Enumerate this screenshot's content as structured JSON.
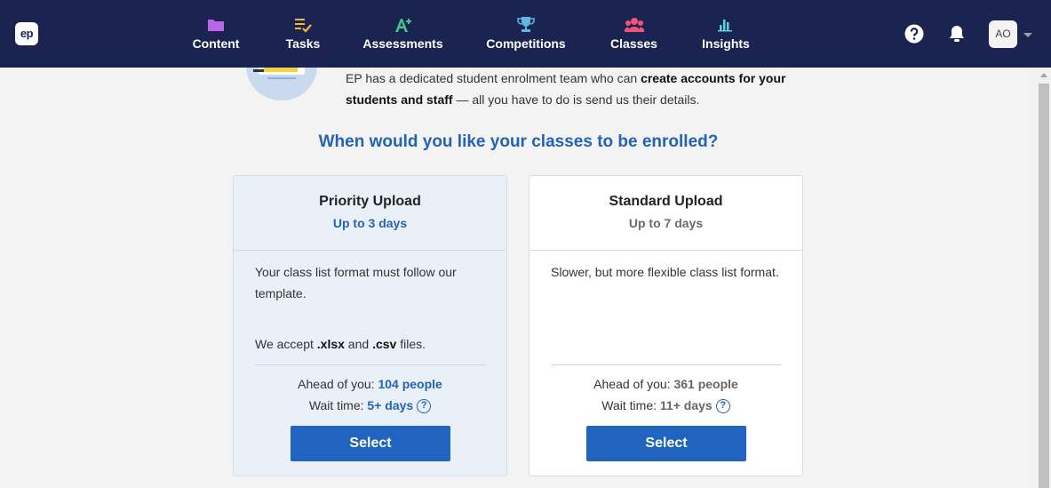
{
  "header": {
    "logo_text": "ep",
    "nav": [
      {
        "label": "Content",
        "icon": "folder-icon",
        "color": "#b967e8"
      },
      {
        "label": "Tasks",
        "icon": "tasks-icon",
        "color": "#f5b82e"
      },
      {
        "label": "Assessments",
        "icon": "assessment-icon",
        "color": "#3cc78a"
      },
      {
        "label": "Competitions",
        "icon": "trophy-icon",
        "color": "#5fb6e0"
      },
      {
        "label": "Classes",
        "icon": "classes-icon",
        "color": "#f0547a"
      },
      {
        "label": "Insights",
        "icon": "insights-icon",
        "color": "#5ad1e6"
      }
    ],
    "avatar_initials": "AO"
  },
  "intro": {
    "text_a": "EP has a dedicated student enrolment team who can ",
    "text_bold": "create accounts for your students and staff",
    "text_b": " — all you have to do is send us their details."
  },
  "question": "When would you like your classes to be enrolled?",
  "cards": [
    {
      "title": "Priority Upload",
      "subtitle": "Up to 3 days",
      "body": "Your class list format must follow our template.",
      "accept_a": "We accept ",
      "accept_xlsx": ".xlsx",
      "accept_and": " and ",
      "accept_csv": ".csv",
      "accept_b": " files.",
      "ahead_label": "Ahead of you: ",
      "ahead_value": "104 people",
      "wait_label": "Wait time: ",
      "wait_value": "5+ days",
      "button": "Select"
    },
    {
      "title": "Standard Upload",
      "subtitle": "Up to 7 days",
      "body": "Slower, but more flexible class list format.",
      "ahead_label": "Ahead of you: ",
      "ahead_value": "361 people",
      "wait_label": "Wait time: ",
      "wait_value": "11+ days",
      "button": "Select"
    }
  ],
  "colors": {
    "navbar": "#1b2350",
    "accent": "#2462b5",
    "button": "#2064bf",
    "priority_card_bg": "#eaf0f8"
  }
}
